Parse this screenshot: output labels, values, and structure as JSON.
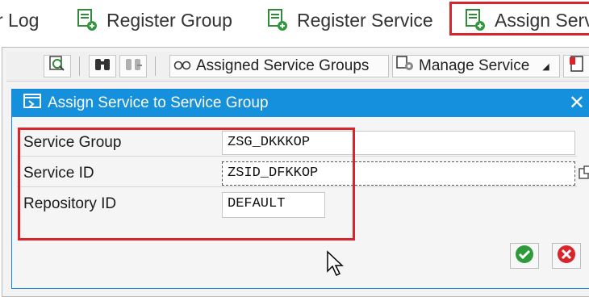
{
  "top_toolbar": {
    "items": [
      {
        "label": "r Log"
      },
      {
        "label": "Register Group"
      },
      {
        "label": "Register Service"
      },
      {
        "label": "Assign Serv"
      }
    ]
  },
  "sub_toolbar": {
    "assigned_groups_label": "Assigned Service Groups",
    "manage_service_label": "Manage Service"
  },
  "dialog": {
    "title": "Assign Service to Service Group",
    "fields": [
      {
        "label": "Service Group",
        "value": "ZSG_DKKKOP"
      },
      {
        "label": "Service ID",
        "value": "ZSID_DFKKOP"
      },
      {
        "label": "Repository ID",
        "value": "DEFAULT"
      }
    ]
  },
  "colors": {
    "title_bar": "#1590dc",
    "highlight": "#d8242b",
    "confirm": "#2e9b3a",
    "cancel": "#d8242b"
  }
}
